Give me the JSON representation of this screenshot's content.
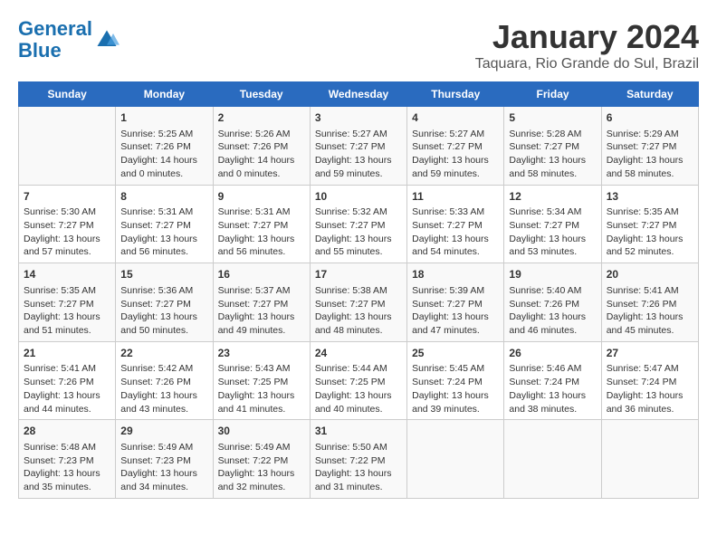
{
  "logo": {
    "line1": "General",
    "line2": "Blue"
  },
  "title": "January 2024",
  "subtitle": "Taquara, Rio Grande do Sul, Brazil",
  "headers": [
    "Sunday",
    "Monday",
    "Tuesday",
    "Wednesday",
    "Thursday",
    "Friday",
    "Saturday"
  ],
  "weeks": [
    [
      {
        "day": "",
        "content": ""
      },
      {
        "day": "1",
        "content": "Sunrise: 5:25 AM\nSunset: 7:26 PM\nDaylight: 14 hours\nand 0 minutes."
      },
      {
        "day": "2",
        "content": "Sunrise: 5:26 AM\nSunset: 7:26 PM\nDaylight: 14 hours\nand 0 minutes."
      },
      {
        "day": "3",
        "content": "Sunrise: 5:27 AM\nSunset: 7:27 PM\nDaylight: 13 hours\nand 59 minutes."
      },
      {
        "day": "4",
        "content": "Sunrise: 5:27 AM\nSunset: 7:27 PM\nDaylight: 13 hours\nand 59 minutes."
      },
      {
        "day": "5",
        "content": "Sunrise: 5:28 AM\nSunset: 7:27 PM\nDaylight: 13 hours\nand 58 minutes."
      },
      {
        "day": "6",
        "content": "Sunrise: 5:29 AM\nSunset: 7:27 PM\nDaylight: 13 hours\nand 58 minutes."
      }
    ],
    [
      {
        "day": "7",
        "content": "Sunrise: 5:30 AM\nSunset: 7:27 PM\nDaylight: 13 hours\nand 57 minutes."
      },
      {
        "day": "8",
        "content": "Sunrise: 5:31 AM\nSunset: 7:27 PM\nDaylight: 13 hours\nand 56 minutes."
      },
      {
        "day": "9",
        "content": "Sunrise: 5:31 AM\nSunset: 7:27 PM\nDaylight: 13 hours\nand 56 minutes."
      },
      {
        "day": "10",
        "content": "Sunrise: 5:32 AM\nSunset: 7:27 PM\nDaylight: 13 hours\nand 55 minutes."
      },
      {
        "day": "11",
        "content": "Sunrise: 5:33 AM\nSunset: 7:27 PM\nDaylight: 13 hours\nand 54 minutes."
      },
      {
        "day": "12",
        "content": "Sunrise: 5:34 AM\nSunset: 7:27 PM\nDaylight: 13 hours\nand 53 minutes."
      },
      {
        "day": "13",
        "content": "Sunrise: 5:35 AM\nSunset: 7:27 PM\nDaylight: 13 hours\nand 52 minutes."
      }
    ],
    [
      {
        "day": "14",
        "content": "Sunrise: 5:35 AM\nSunset: 7:27 PM\nDaylight: 13 hours\nand 51 minutes."
      },
      {
        "day": "15",
        "content": "Sunrise: 5:36 AM\nSunset: 7:27 PM\nDaylight: 13 hours\nand 50 minutes."
      },
      {
        "day": "16",
        "content": "Sunrise: 5:37 AM\nSunset: 7:27 PM\nDaylight: 13 hours\nand 49 minutes."
      },
      {
        "day": "17",
        "content": "Sunrise: 5:38 AM\nSunset: 7:27 PM\nDaylight: 13 hours\nand 48 minutes."
      },
      {
        "day": "18",
        "content": "Sunrise: 5:39 AM\nSunset: 7:27 PM\nDaylight: 13 hours\nand 47 minutes."
      },
      {
        "day": "19",
        "content": "Sunrise: 5:40 AM\nSunset: 7:26 PM\nDaylight: 13 hours\nand 46 minutes."
      },
      {
        "day": "20",
        "content": "Sunrise: 5:41 AM\nSunset: 7:26 PM\nDaylight: 13 hours\nand 45 minutes."
      }
    ],
    [
      {
        "day": "21",
        "content": "Sunrise: 5:41 AM\nSunset: 7:26 PM\nDaylight: 13 hours\nand 44 minutes."
      },
      {
        "day": "22",
        "content": "Sunrise: 5:42 AM\nSunset: 7:26 PM\nDaylight: 13 hours\nand 43 minutes."
      },
      {
        "day": "23",
        "content": "Sunrise: 5:43 AM\nSunset: 7:25 PM\nDaylight: 13 hours\nand 41 minutes."
      },
      {
        "day": "24",
        "content": "Sunrise: 5:44 AM\nSunset: 7:25 PM\nDaylight: 13 hours\nand 40 minutes."
      },
      {
        "day": "25",
        "content": "Sunrise: 5:45 AM\nSunset: 7:24 PM\nDaylight: 13 hours\nand 39 minutes."
      },
      {
        "day": "26",
        "content": "Sunrise: 5:46 AM\nSunset: 7:24 PM\nDaylight: 13 hours\nand 38 minutes."
      },
      {
        "day": "27",
        "content": "Sunrise: 5:47 AM\nSunset: 7:24 PM\nDaylight: 13 hours\nand 36 minutes."
      }
    ],
    [
      {
        "day": "28",
        "content": "Sunrise: 5:48 AM\nSunset: 7:23 PM\nDaylight: 13 hours\nand 35 minutes."
      },
      {
        "day": "29",
        "content": "Sunrise: 5:49 AM\nSunset: 7:23 PM\nDaylight: 13 hours\nand 34 minutes."
      },
      {
        "day": "30",
        "content": "Sunrise: 5:49 AM\nSunset: 7:22 PM\nDaylight: 13 hours\nand 32 minutes."
      },
      {
        "day": "31",
        "content": "Sunrise: 5:50 AM\nSunset: 7:22 PM\nDaylight: 13 hours\nand 31 minutes."
      },
      {
        "day": "",
        "content": ""
      },
      {
        "day": "",
        "content": ""
      },
      {
        "day": "",
        "content": ""
      }
    ]
  ]
}
